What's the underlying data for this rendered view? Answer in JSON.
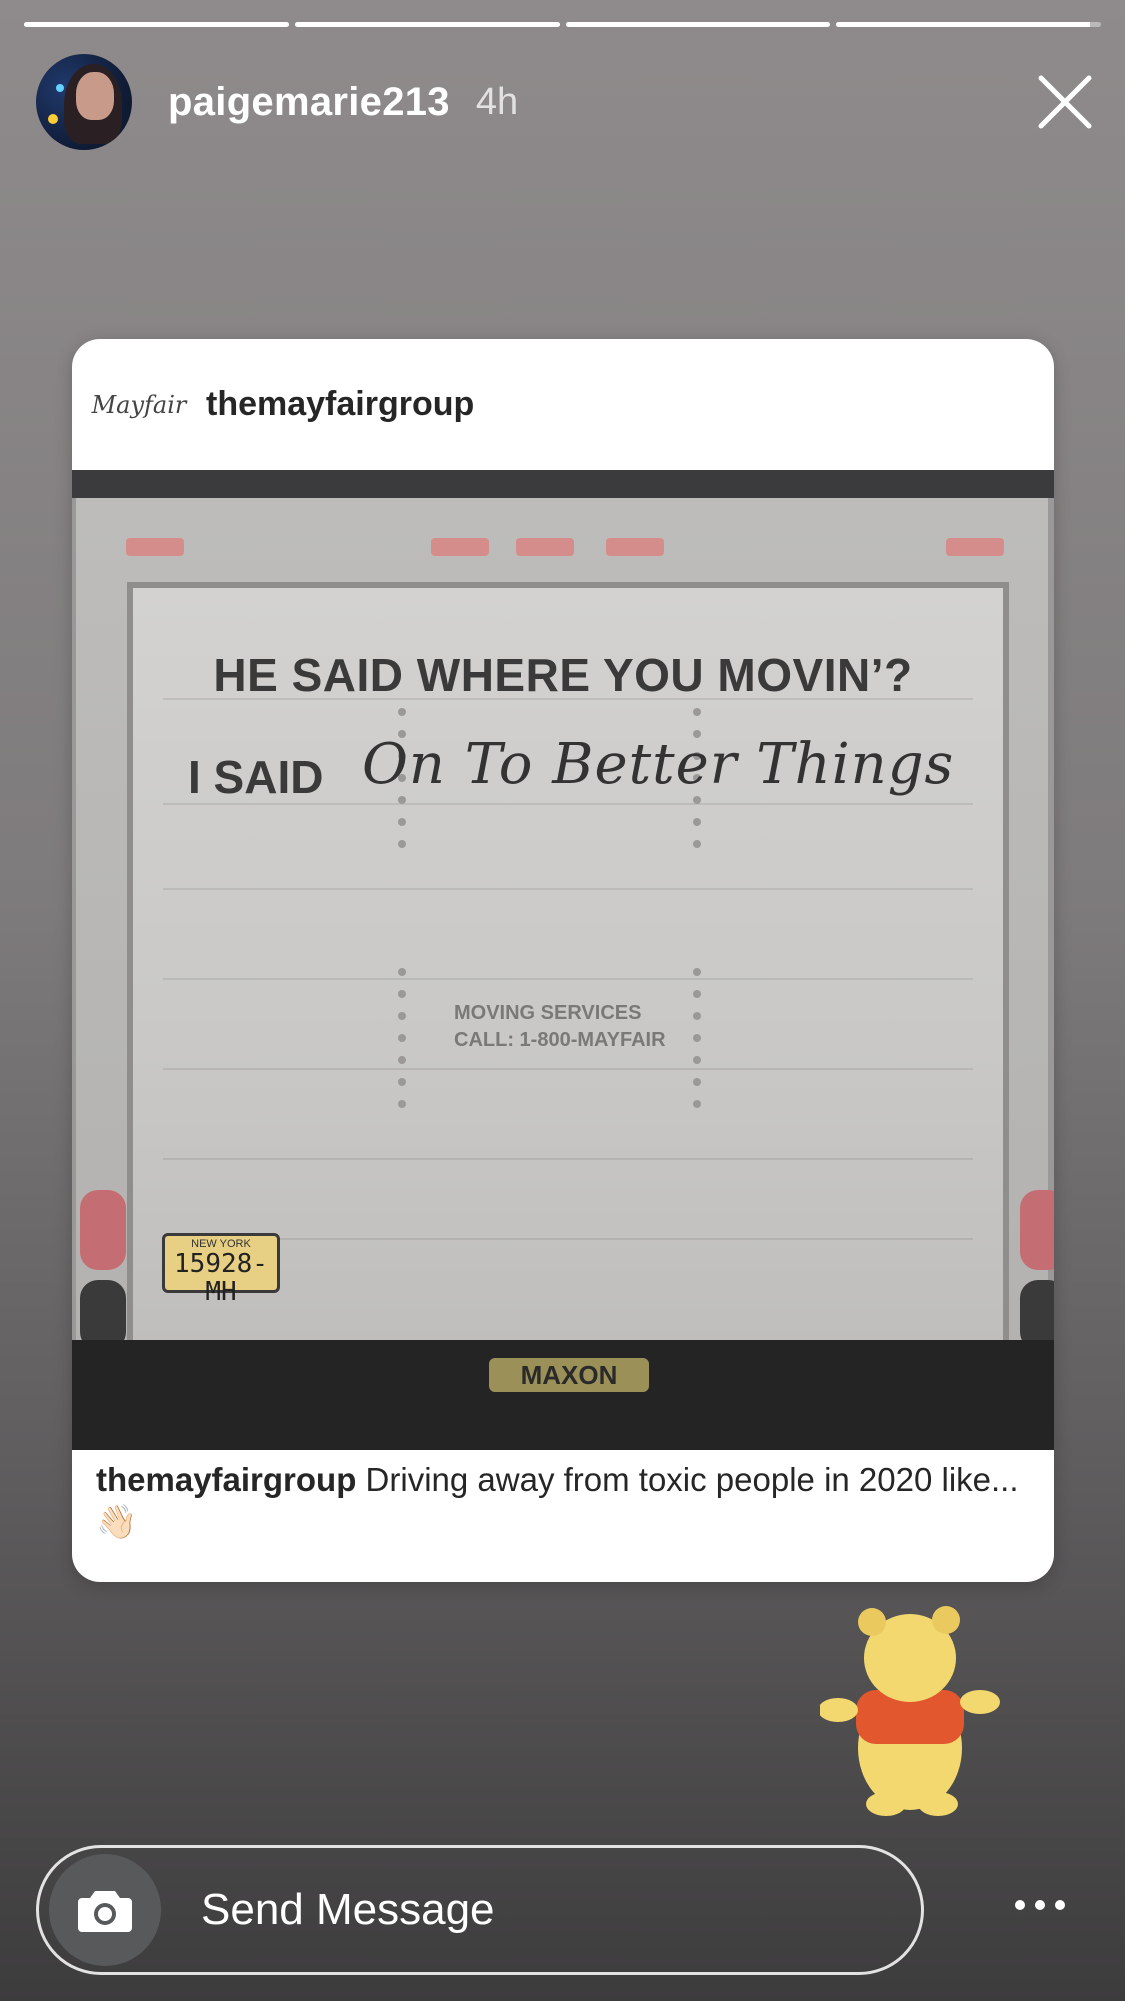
{
  "story": {
    "progress_segments": [
      1,
      1,
      1,
      0.96
    ],
    "username": "paigemarie213",
    "time_ago": "4h"
  },
  "post": {
    "account": "themayfairgroup",
    "logo_text": "Mayfair",
    "truck_text": {
      "line1": "HE SAID WHERE YOU MOVIN’?",
      "line2_lead": "I SAID",
      "line2_script": "On To Better Things",
      "service_line1": "MOVING SERVICES",
      "service_line2": "CALL: 1-800-MAYFAIR",
      "plate_state": "NEW YORK",
      "plate_number": "15928-MH",
      "lift_brand": "MAXON"
    },
    "caption_user": "themayfairgroup",
    "caption_text": " Driving away from toxic people in 2020 like... 👋🏻"
  },
  "footer": {
    "message_placeholder": "Send Message"
  },
  "icons": {
    "close": "close-icon",
    "camera": "camera-icon",
    "more": "more-options-icon",
    "sticker": "winnie-the-pooh-sticker"
  }
}
